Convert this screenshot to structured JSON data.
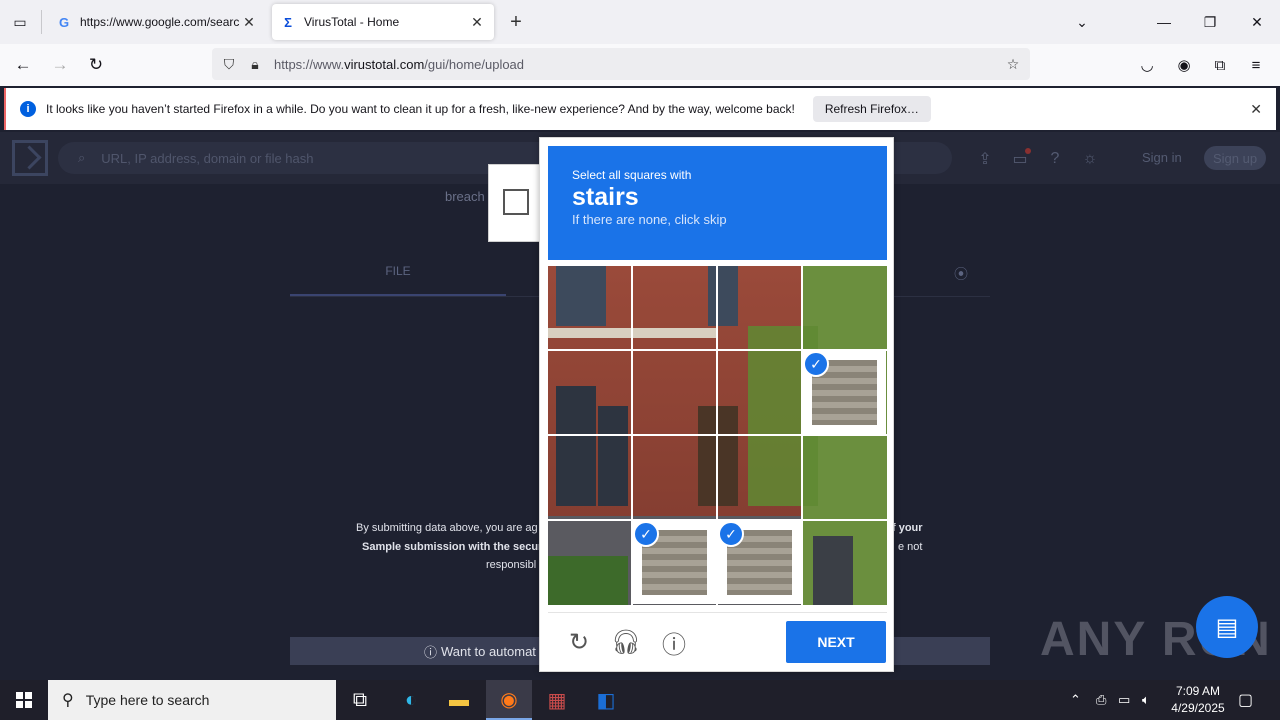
{
  "browser": {
    "tabs": [
      {
        "title": "https://www.google.com/search",
        "favicon": "G",
        "active": false
      },
      {
        "title": "VirusTotal - Home",
        "favicon": "Σ",
        "active": true
      }
    ],
    "url_prefix": "https://www.",
    "url_domain": "virustotal.com",
    "url_path": "/gui/home/upload",
    "notification": {
      "message": "It looks like you haven’t started Firefox in a while. Do you want to clean it up for a fresh, like-new experience? And by the way, welcome back!",
      "button": "Refresh Firefox…"
    }
  },
  "vt": {
    "search_placeholder": "URL, IP address, domain or file hash",
    "sign_in": "Sign in",
    "sign_up": "Sign up",
    "breach_fragment": "breach",
    "file_tab": "FILE",
    "terms_line1": "By submitting data above, you are ag",
    "terms_line2": "Sample submission with the secur",
    "terms_line3": "responsibl",
    "terms_right1": "f your",
    "terms_right2": "e not",
    "automate": "Want to automat"
  },
  "captcha": {
    "instruction": "Select all squares with",
    "target": "stairs",
    "hint": "If there are none, click skip",
    "next_label": "NEXT",
    "selected_cells": [
      7,
      13,
      14
    ],
    "brand_color": "#1a73e8"
  },
  "watermark": "ANY RUN",
  "taskbar": {
    "search_placeholder": "Type here to search",
    "time": "7:09 AM",
    "date": "4/29/2025"
  }
}
